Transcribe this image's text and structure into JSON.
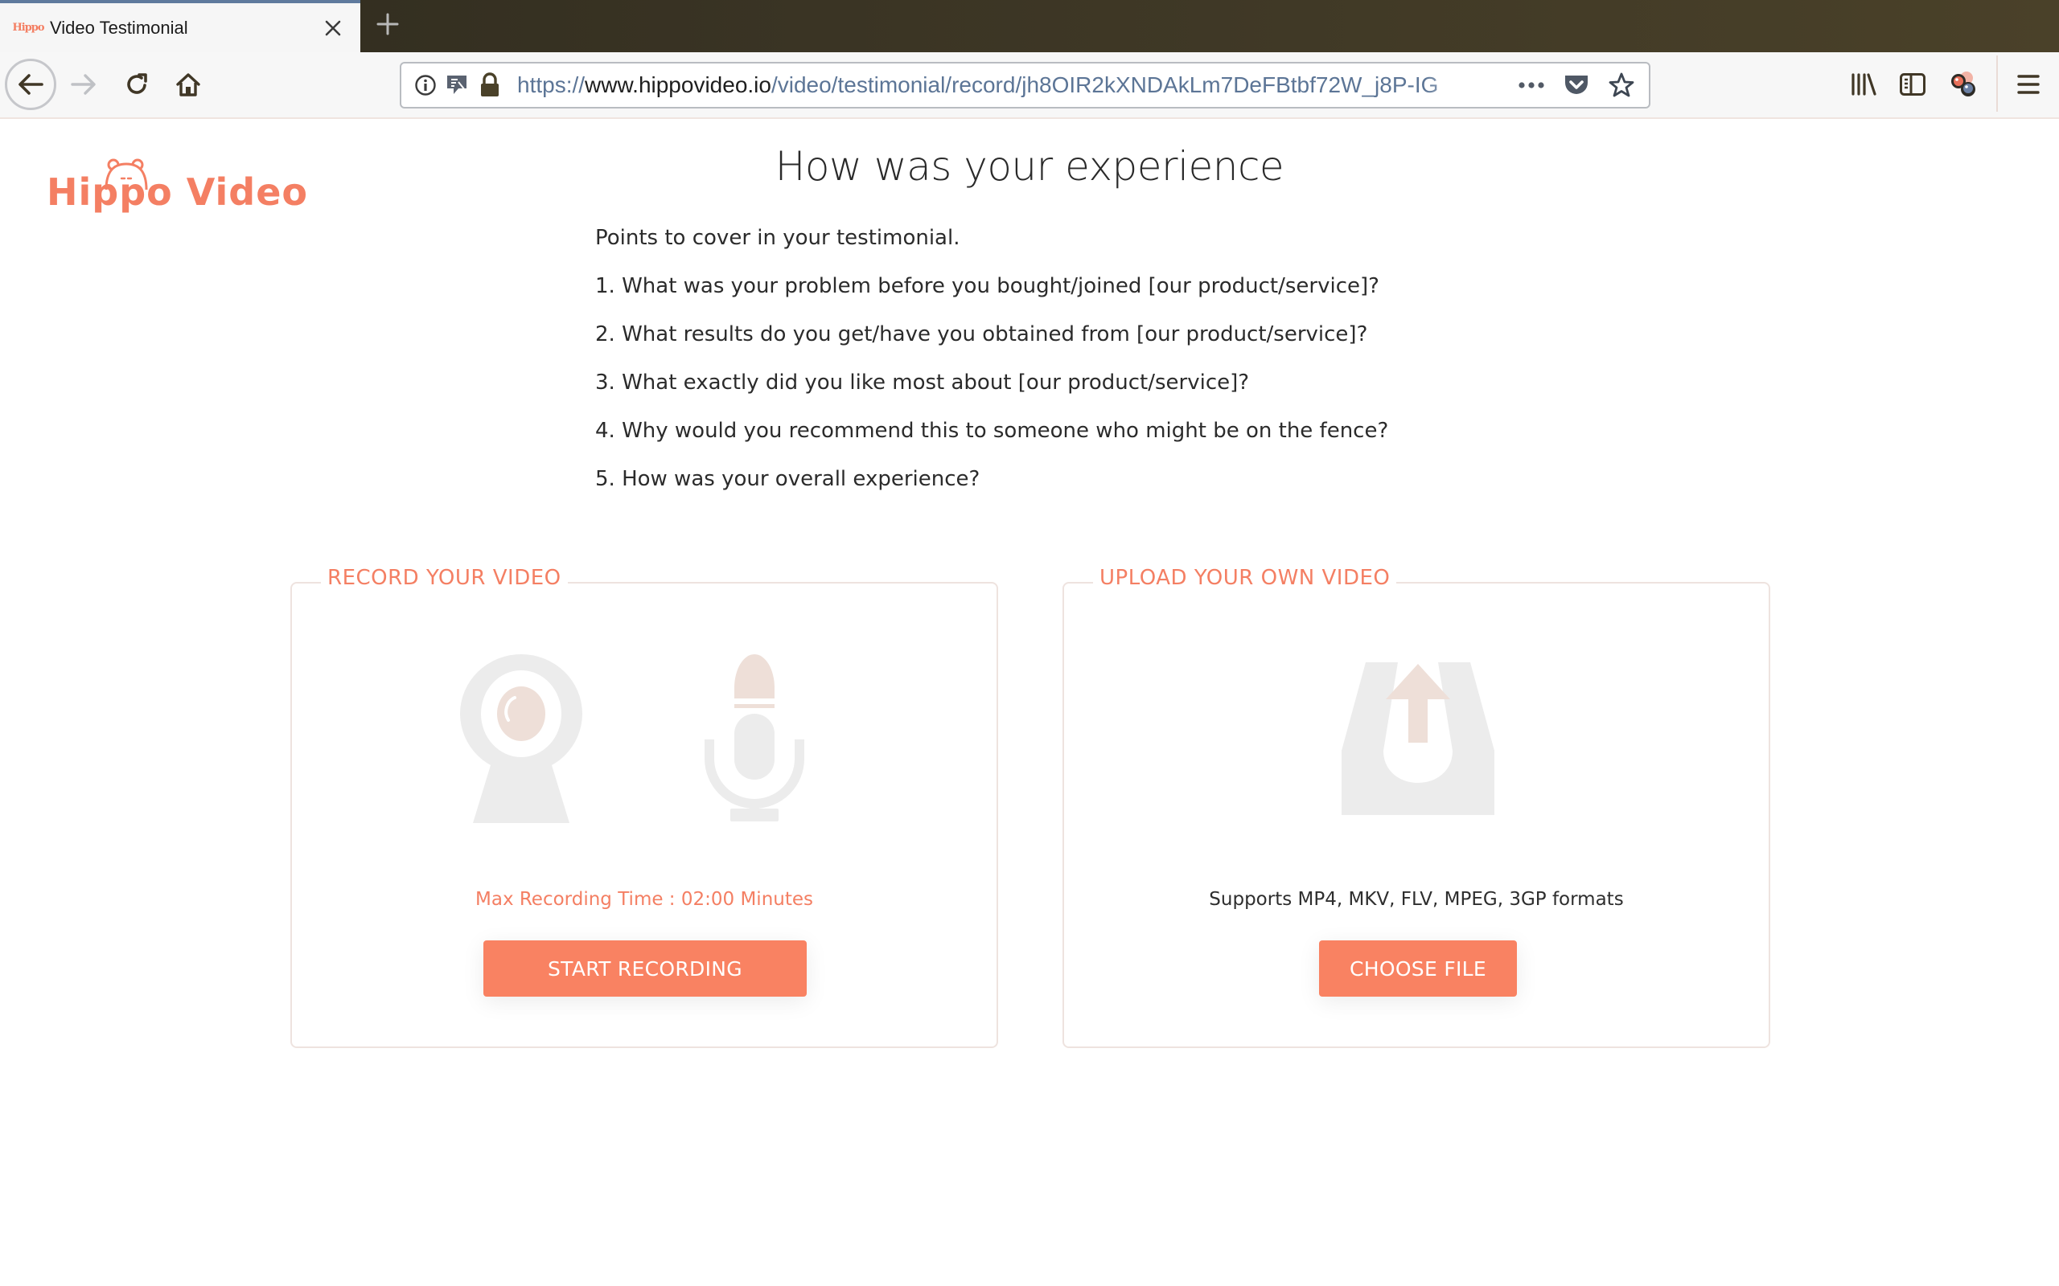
{
  "browser": {
    "tab": {
      "favicon_text": "Hippo",
      "title": "Video Testimonial"
    },
    "url": {
      "scheme": "https://",
      "host": "www.hippovideo.io",
      "path": "/video/testimonial/record/jh8OIR2kXNDAkLm7DeFBtbf72W_j8P-IG"
    },
    "icons": {
      "back": "back-arrow-icon",
      "forward": "forward-arrow-icon",
      "reload": "reload-icon",
      "home": "home-icon",
      "site_info": "info-icon",
      "permissions": "permissions-icon",
      "secure": "lock-icon",
      "page_actions": "ellipsis-icon",
      "pocket": "pocket-icon",
      "bookmark": "star-icon",
      "library": "library-icon",
      "sidebar": "sidebar-icon",
      "extension": "extension-icon",
      "menu": "hamburger-menu-icon"
    }
  },
  "page": {
    "logo_text": "Hippo Video",
    "title": "How was your experience",
    "intro": "Points to cover in your testimonial.",
    "points": [
      "1. What was your problem before you bought/joined [our product/service]?",
      "2. What results do you get/have you obtained from [our product/service]?",
      "3. What exactly did you like most about [our product/service]?",
      "4. Why would you recommend this to someone who might be on the fence?",
      "5. How was your overall experience?"
    ],
    "record": {
      "legend": "RECORD YOUR VIDEO",
      "note": "Max Recording Time : 02:00 Minutes",
      "button": "START RECORDING",
      "icons": [
        "webcam-icon",
        "microphone-icon"
      ]
    },
    "upload": {
      "legend": "UPLOAD YOUR OWN VIDEO",
      "note": "Supports MP4, MKV, FLV, MPEG, 3GP formats",
      "button": "CHOOSE FILE",
      "icons": [
        "upload-tray-icon"
      ]
    }
  },
  "colors": {
    "brand": "#f47f63",
    "button": "#f98262",
    "icon_gray": "#ececec",
    "icon_tint": "#eeddd6",
    "card_border": "#eee3df",
    "url_path": "#5c7596"
  }
}
